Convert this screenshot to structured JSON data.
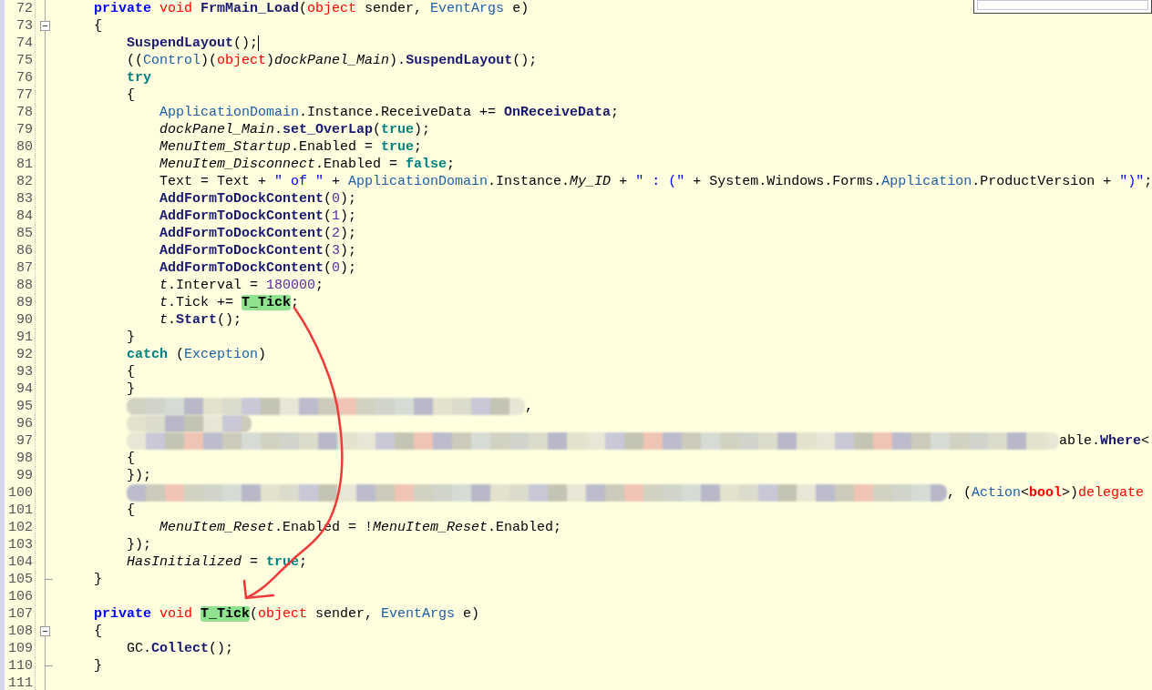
{
  "popup": {
    "visible": true
  },
  "lines": [
    {
      "number": "72",
      "cursor": false,
      "tokens": [
        {
          "kind": "keyword",
          "text": "    private "
        },
        {
          "kind": "red",
          "text": "void "
        },
        {
          "kind": "method",
          "text": "FrmMain_Load"
        },
        {
          "kind": "plain",
          "text": "("
        },
        {
          "kind": "red",
          "text": "object"
        },
        {
          "kind": "plain",
          "text": " sender, "
        },
        {
          "kind": "type",
          "text": "EventArgs"
        },
        {
          "kind": "plain",
          "text": " e)"
        }
      ]
    },
    {
      "number": "73",
      "cursor": false,
      "fold_start": true,
      "tokens": [
        {
          "kind": "plain",
          "text": "    {"
        }
      ]
    },
    {
      "number": "74",
      "cursor": true,
      "tokens": [
        {
          "kind": "method",
          "text": "        SuspendLayout"
        },
        {
          "kind": "plain",
          "text": "();"
        }
      ]
    },
    {
      "number": "75",
      "cursor": false,
      "tokens": [
        {
          "kind": "plain",
          "text": "        (("
        },
        {
          "kind": "type",
          "text": "Control"
        },
        {
          "kind": "plain",
          "text": ")("
        },
        {
          "kind": "red",
          "text": "object"
        },
        {
          "kind": "plain",
          "text": ")"
        },
        {
          "kind": "field",
          "text": "dockPanel_Main"
        },
        {
          "kind": "plain",
          "text": ")."
        },
        {
          "kind": "method",
          "text": "SuspendLayout"
        },
        {
          "kind": "plain",
          "text": "();"
        }
      ]
    },
    {
      "number": "76",
      "cursor": false,
      "tokens": [
        {
          "kind": "constant",
          "text": "        try"
        }
      ]
    },
    {
      "number": "77",
      "cursor": false,
      "tokens": [
        {
          "kind": "plain",
          "text": "        {"
        }
      ]
    },
    {
      "number": "78",
      "cursor": false,
      "tokens": [
        {
          "kind": "type",
          "text": "            ApplicationDomain"
        },
        {
          "kind": "plain",
          "text": ".Instance.ReceiveData += "
        },
        {
          "kind": "method",
          "text": "OnReceiveData"
        },
        {
          "kind": "plain",
          "text": ";"
        }
      ]
    },
    {
      "number": "79",
      "cursor": false,
      "tokens": [
        {
          "kind": "field",
          "text": "            dockPanel_Main"
        },
        {
          "kind": "plain",
          "text": "."
        },
        {
          "kind": "method",
          "text": "set_OverLap"
        },
        {
          "kind": "plain",
          "text": "("
        },
        {
          "kind": "constant",
          "text": "true"
        },
        {
          "kind": "plain",
          "text": ");"
        }
      ]
    },
    {
      "number": "80",
      "cursor": false,
      "tokens": [
        {
          "kind": "field",
          "text": "            MenuItem_Startup"
        },
        {
          "kind": "plain",
          "text": ".Enabled = "
        },
        {
          "kind": "constant",
          "text": "true"
        },
        {
          "kind": "plain",
          "text": ";"
        }
      ]
    },
    {
      "number": "81",
      "cursor": false,
      "tokens": [
        {
          "kind": "field",
          "text": "            MenuItem_Disconnect"
        },
        {
          "kind": "plain",
          "text": ".Enabled = "
        },
        {
          "kind": "constant",
          "text": "false"
        },
        {
          "kind": "plain",
          "text": ";"
        }
      ]
    },
    {
      "number": "82",
      "cursor": false,
      "tokens": [
        {
          "kind": "plain",
          "text": "            Text = Text + "
        },
        {
          "kind": "string",
          "text": "\" of \""
        },
        {
          "kind": "plain",
          "text": " + "
        },
        {
          "kind": "type",
          "text": "ApplicationDomain"
        },
        {
          "kind": "plain",
          "text": ".Instance."
        },
        {
          "kind": "field",
          "text": "My_ID"
        },
        {
          "kind": "plain",
          "text": " + "
        },
        {
          "kind": "string",
          "text": "\" : (\""
        },
        {
          "kind": "plain",
          "text": " + System.Windows.Forms."
        },
        {
          "kind": "type",
          "text": "Application"
        },
        {
          "kind": "plain",
          "text": ".ProductVersion + "
        },
        {
          "kind": "string",
          "text": "\")\""
        },
        {
          "kind": "plain",
          "text": ";"
        }
      ]
    },
    {
      "number": "83",
      "cursor": false,
      "tokens": [
        {
          "kind": "method",
          "text": "            AddFormToDockContent"
        },
        {
          "kind": "plain",
          "text": "("
        },
        {
          "kind": "number",
          "text": "0"
        },
        {
          "kind": "plain",
          "text": ");"
        }
      ]
    },
    {
      "number": "84",
      "cursor": false,
      "tokens": [
        {
          "kind": "method",
          "text": "            AddFormToDockContent"
        },
        {
          "kind": "plain",
          "text": "("
        },
        {
          "kind": "number",
          "text": "1"
        },
        {
          "kind": "plain",
          "text": ");"
        }
      ]
    },
    {
      "number": "85",
      "cursor": false,
      "tokens": [
        {
          "kind": "method",
          "text": "            AddFormToDockContent"
        },
        {
          "kind": "plain",
          "text": "("
        },
        {
          "kind": "number",
          "text": "2"
        },
        {
          "kind": "plain",
          "text": ");"
        }
      ]
    },
    {
      "number": "86",
      "cursor": false,
      "tokens": [
        {
          "kind": "method",
          "text": "            AddFormToDockContent"
        },
        {
          "kind": "plain",
          "text": "("
        },
        {
          "kind": "number",
          "text": "3"
        },
        {
          "kind": "plain",
          "text": ");"
        }
      ]
    },
    {
      "number": "87",
      "cursor": false,
      "tokens": [
        {
          "kind": "method",
          "text": "            AddFormToDockContent"
        },
        {
          "kind": "plain",
          "text": "("
        },
        {
          "kind": "number",
          "text": "0"
        },
        {
          "kind": "plain",
          "text": ");"
        }
      ]
    },
    {
      "number": "88",
      "cursor": false,
      "tokens": [
        {
          "kind": "field",
          "text": "            t"
        },
        {
          "kind": "plain",
          "text": ".Interval = "
        },
        {
          "kind": "number",
          "text": "180000"
        },
        {
          "kind": "plain",
          "text": ";"
        }
      ]
    },
    {
      "number": "89",
      "cursor": false,
      "tokens": [
        {
          "kind": "field",
          "text": "            t"
        },
        {
          "kind": "plain",
          "text": ".Tick += "
        },
        {
          "kind": "match",
          "text": "T_Tick"
        },
        {
          "kind": "plain",
          "text": ";"
        }
      ]
    },
    {
      "number": "90",
      "cursor": false,
      "tokens": [
        {
          "kind": "field",
          "text": "            t"
        },
        {
          "kind": "plain",
          "text": "."
        },
        {
          "kind": "method",
          "text": "Start"
        },
        {
          "kind": "plain",
          "text": "();"
        }
      ]
    },
    {
      "number": "91",
      "cursor": false,
      "tokens": [
        {
          "kind": "plain",
          "text": "        }"
        }
      ]
    },
    {
      "number": "92",
      "cursor": false,
      "tokens": [
        {
          "kind": "constant",
          "text": "        catch"
        },
        {
          "kind": "plain",
          "text": " ("
        },
        {
          "kind": "type",
          "text": "Exception"
        },
        {
          "kind": "plain",
          "text": ")"
        }
      ]
    },
    {
      "number": "93",
      "cursor": false,
      "tokens": [
        {
          "kind": "plain",
          "text": "        {"
        }
      ]
    },
    {
      "number": "94",
      "cursor": false,
      "tokens": [
        {
          "kind": "plain",
          "text": "        }"
        }
      ]
    },
    {
      "number": "95",
      "cursor": false,
      "tokens": [
        {
          "kind": "redacted"
        },
        {
          "kind": "plain",
          "text": ","
        }
      ]
    },
    {
      "number": "96",
      "cursor": false,
      "tokens": [
        {
          "kind": "redacted"
        }
      ]
    },
    {
      "number": "97",
      "cursor": false,
      "tokens": [
        {
          "kind": "redacted"
        },
        {
          "kind": "plain",
          "text": "able."
        },
        {
          "kind": "method",
          "text": "Where"
        },
        {
          "kind": "plain",
          "text": "<"
        }
      ]
    },
    {
      "number": "98",
      "cursor": false,
      "tokens": [
        {
          "kind": "plain",
          "text": "        {"
        }
      ]
    },
    {
      "number": "99",
      "cursor": false,
      "tokens": [
        {
          "kind": "plain",
          "text": "        });"
        }
      ]
    },
    {
      "number": "100",
      "cursor": false,
      "tokens": [
        {
          "kind": "redacted"
        },
        {
          "kind": "plain",
          "text": ", ("
        },
        {
          "kind": "type",
          "text": "Action"
        },
        {
          "kind": "plain",
          "text": "<"
        },
        {
          "kind": "redbold",
          "text": "bool"
        },
        {
          "kind": "plain",
          "text": ">)"
        },
        {
          "kind": "red",
          "text": "delegate"
        }
      ]
    },
    {
      "number": "101",
      "cursor": false,
      "tokens": [
        {
          "kind": "plain",
          "text": "        {"
        }
      ]
    },
    {
      "number": "102",
      "cursor": false,
      "tokens": [
        {
          "kind": "field",
          "text": "            MenuItem_Reset"
        },
        {
          "kind": "plain",
          "text": ".Enabled = !"
        },
        {
          "kind": "field",
          "text": "MenuItem_Reset"
        },
        {
          "kind": "plain",
          "text": ".Enabled;"
        }
      ]
    },
    {
      "number": "103",
      "cursor": false,
      "tokens": [
        {
          "kind": "plain",
          "text": "        });"
        }
      ]
    },
    {
      "number": "104",
      "cursor": false,
      "tokens": [
        {
          "kind": "field",
          "text": "        HasInitialized"
        },
        {
          "kind": "plain",
          "text": " = "
        },
        {
          "kind": "constant",
          "text": "true"
        },
        {
          "kind": "plain",
          "text": ";"
        }
      ]
    },
    {
      "number": "105",
      "cursor": false,
      "fold_end": true,
      "tokens": [
        {
          "kind": "plain",
          "text": "    }"
        }
      ]
    },
    {
      "number": "106",
      "cursor": false
    },
    {
      "number": "107",
      "cursor": false,
      "tokens": [
        {
          "kind": "keyword",
          "text": "    private "
        },
        {
          "kind": "red",
          "text": "void "
        },
        {
          "kind": "match",
          "text": "T_Tick"
        },
        {
          "kind": "plain",
          "text": "("
        },
        {
          "kind": "red",
          "text": "object"
        },
        {
          "kind": "plain",
          "text": " sender, "
        },
        {
          "kind": "type",
          "text": "EventArgs"
        },
        {
          "kind": "plain",
          "text": " e)"
        }
      ]
    },
    {
      "number": "108",
      "cursor": false,
      "fold_start": true,
      "tokens": [
        {
          "kind": "plain",
          "text": "    {"
        }
      ]
    },
    {
      "number": "109",
      "cursor": false,
      "tokens": [
        {
          "kind": "plain",
          "text": "        GC."
        },
        {
          "kind": "method",
          "text": "Collect"
        },
        {
          "kind": "plain",
          "text": "();"
        }
      ]
    },
    {
      "number": "110",
      "cursor": false,
      "fold_end": true,
      "tokens": [
        {
          "kind": "plain",
          "text": "    }"
        }
      ]
    },
    {
      "number": "111",
      "cursor": false
    }
  ],
  "annotations": [
    {
      "kind": "arrow"
    }
  ]
}
